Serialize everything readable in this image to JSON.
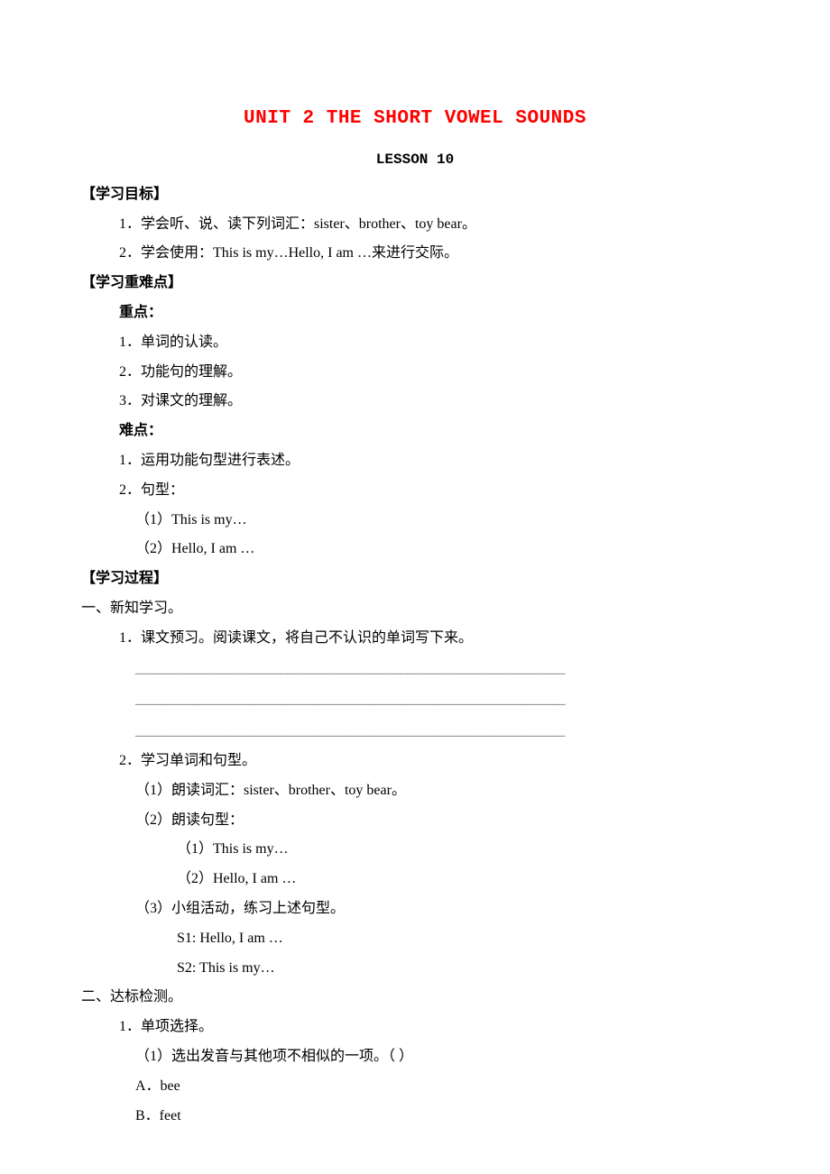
{
  "title": "UNIT 2 THE SHORT VOWEL SOUNDS",
  "subtitle": "LESSON 10",
  "sections": {
    "objectives": {
      "header": "【学习目标】",
      "items": [
        "1．学会听、说、读下列词汇：sister、brother、toy bear。",
        "2．学会使用：This is my…Hello, I am …来进行交际。"
      ]
    },
    "keypoints": {
      "header": "【学习重难点】",
      "zhongdian_label": "重点：",
      "zhongdian_items": [
        "1．单词的认读。",
        "2．功能句的理解。",
        "3．对课文的理解。"
      ],
      "nandian_label": "难点：",
      "nandian_items": [
        "1．运用功能句型进行表述。",
        "2．句型："
      ],
      "nandian_sub": [
        "（1）This is my…",
        "（2）Hello, I am …"
      ]
    },
    "process": {
      "header": "【学习过程】",
      "part1_label": "一、新知学习。",
      "p1_item1": "1．课文预习。阅读课文，将自己不认识的单词写下来。",
      "blank": "____________________________________________________________________",
      "p1_item2": "2．学习单词和句型。",
      "p1_sub1": "（1）朗读词汇：sister、brother、toy bear。",
      "p1_sub2": "（2）朗读句型：",
      "p1_sub2_a": "（1）This is my…",
      "p1_sub2_b": "（2）Hello, I am …",
      "p1_sub3": "（3）小组活动，练习上述句型。",
      "p1_sub3_a": "S1: Hello, I am …",
      "p1_sub3_b": "S2: This is my…",
      "part2_label": "二、达标检测。",
      "p2_item1": "1．单项选择。",
      "p2_q1": "（1）选出发音与其他项不相似的一项。（  ）",
      "p2_a": "A．bee",
      "p2_b": "B．feet"
    }
  }
}
